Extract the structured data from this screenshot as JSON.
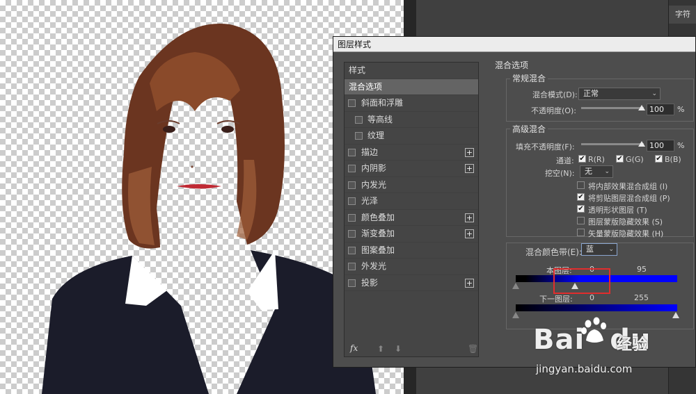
{
  "side_panel": {
    "tab_label": "字符"
  },
  "dialog": {
    "title": "图层样式",
    "style_list": {
      "header": "样式",
      "selected": "混合选项",
      "items": [
        {
          "label": "斜面和浮雕",
          "checked": false,
          "indent": false,
          "plus": false
        },
        {
          "label": "等高线",
          "checked": false,
          "indent": true,
          "plus": false
        },
        {
          "label": "纹理",
          "checked": false,
          "indent": true,
          "plus": false
        },
        {
          "label": "描边",
          "checked": false,
          "indent": false,
          "plus": true
        },
        {
          "label": "内阴影",
          "checked": false,
          "indent": false,
          "plus": true
        },
        {
          "label": "内发光",
          "checked": false,
          "indent": false,
          "plus": false
        },
        {
          "label": "光泽",
          "checked": false,
          "indent": false,
          "plus": false
        },
        {
          "label": "颜色叠加",
          "checked": false,
          "indent": false,
          "plus": true
        },
        {
          "label": "渐变叠加",
          "checked": false,
          "indent": false,
          "plus": true
        },
        {
          "label": "图案叠加",
          "checked": false,
          "indent": false,
          "plus": false
        },
        {
          "label": "外发光",
          "checked": false,
          "indent": false,
          "plus": false
        },
        {
          "label": "投影",
          "checked": false,
          "indent": false,
          "plus": true
        }
      ],
      "footer_fx": "fx"
    },
    "blend_options": {
      "section_title": "混合选项",
      "general": {
        "title": "常规混合",
        "blend_mode_label": "混合模式(D):",
        "blend_mode_value": "正常",
        "opacity_label": "不透明度(O):",
        "opacity_value": "100",
        "opacity_unit": "%",
        "opacity_level": 1.0
      },
      "advanced": {
        "title": "高级混合",
        "fill_opacity_label": "填充不透明度(F):",
        "fill_opacity_value": "100",
        "fill_opacity_unit": "%",
        "fill_opacity_level": 1.0,
        "channels_label": "通道:",
        "channel_r": "R(R)",
        "channel_g": "G(G)",
        "channel_b": "B(B)",
        "knockout_label": "挖空(N):",
        "knockout_value": "无",
        "options": [
          {
            "label": "将内部效果混合成组 (I)",
            "checked": false
          },
          {
            "label": "将剪贴图层混合成组 (P)",
            "checked": true
          },
          {
            "label": "透明形状图层 (T)",
            "checked": true
          },
          {
            "label": "图层蒙版隐藏效果 (S)",
            "checked": false
          },
          {
            "label": "矢量蒙版隐藏效果 (H)",
            "checked": false
          }
        ]
      },
      "blend_if": {
        "label": "混合颜色带(E):",
        "value": "蓝",
        "this_layer_label": "本图层:",
        "this_layer_low": "0",
        "this_layer_high": "95",
        "underlying_label": "下一图层:",
        "underlying_low": "0",
        "underlying_high": "255"
      }
    }
  },
  "watermark": {
    "logo": "Bai",
    "logo2": "du",
    "brand": "经验",
    "url": "jingyan.baidu.com"
  }
}
